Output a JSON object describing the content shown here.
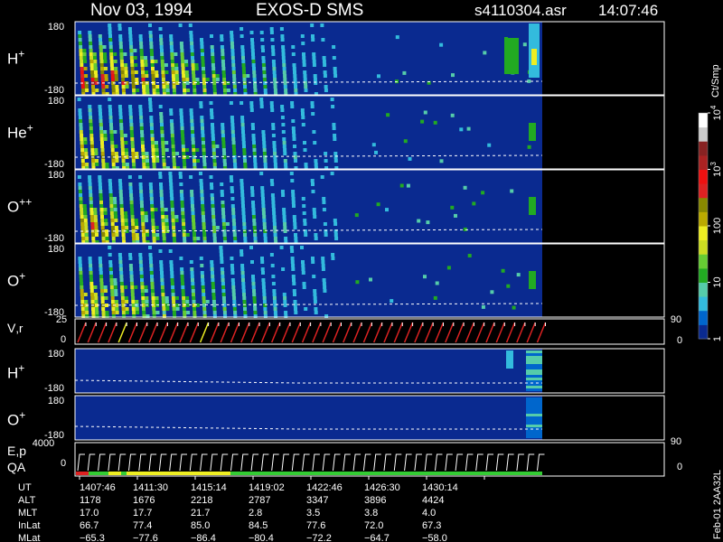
{
  "header": {
    "date": "Nov 03, 1994",
    "mission": "EXOS-D SMS",
    "file": "s4110304.asr",
    "time": "14:07:46"
  },
  "colorbar": {
    "label": "Ct/Smp",
    "ticks": [
      {
        "value": 1,
        "label": "1"
      },
      {
        "value": 10,
        "label": "10"
      },
      {
        "value": 100,
        "label": "100"
      },
      {
        "value": 1000,
        "label": "3",
        "base": "10"
      },
      {
        "value": 10000,
        "label": "4",
        "base": "10"
      }
    ],
    "colors": [
      "#0a2a90",
      "#0066cc",
      "#33bbdd",
      "#55ccaa",
      "#22aa22",
      "#66cc33",
      "#ccdd22",
      "#eeee22",
      "#bbaa00",
      "#888800",
      "#dd2222",
      "#ee1111",
      "#aa2222",
      "#882222",
      "#cccccc",
      "#ffffff"
    ]
  },
  "chart_data": {
    "type": "heatmap",
    "time_axis": {
      "range": [
        "1407:46",
        "1432:00"
      ],
      "tick_labels": [
        "1407:46",
        "1411:30",
        "1415:14",
        "1419:02",
        "1422:46",
        "1426:30",
        "1430:14"
      ]
    },
    "panels": [
      {
        "id": "H",
        "species": "H",
        "charge": "+",
        "ylim": [
          -180,
          180
        ],
        "ytick_labels": [
          "180",
          "-180"
        ],
        "band_max_fraction": 1.0
      },
      {
        "id": "He",
        "species": "He",
        "charge": "+",
        "ylim": [
          -180,
          180
        ],
        "ytick_labels": [
          "180",
          "-180"
        ],
        "band_max_fraction": 0.8
      },
      {
        "id": "Opp",
        "species": "O",
        "charge": "++",
        "ylim": [
          -180,
          180
        ],
        "ytick_labels": [
          "180",
          "-180"
        ],
        "band_max_fraction": 0.85
      },
      {
        "id": "O",
        "species": "O",
        "charge": "+",
        "ylim": [
          -180,
          180
        ],
        "ytick_labels": [
          "180",
          "-180"
        ],
        "band_max_fraction": 0.75
      }
    ],
    "vr_panel": {
      "label_main": "V",
      "label_sub": ",r",
      "ytick_labels": [
        "25",
        "0"
      ],
      "right_ticks": [
        "90",
        "0"
      ]
    },
    "lower_panels": [
      {
        "id": "H2",
        "species": "H",
        "charge": "+",
        "ytick_labels": [
          "180",
          "-180"
        ]
      },
      {
        "id": "O2",
        "species": "O",
        "charge": "+",
        "ytick_labels": [
          "180",
          "-180"
        ]
      }
    ],
    "ep_panel": {
      "label_top": "E,p",
      "label_bottom": "QA",
      "ytick_labels": [
        "4000",
        "0"
      ],
      "right_ticks": [
        "90",
        "0"
      ]
    }
  },
  "orbit_table": {
    "rows": [
      {
        "label": "UT",
        "values": [
          "1407:46",
          "1411:30",
          "1415:14",
          "1419:02",
          "1422:46",
          "1426:30",
          "1430:14"
        ]
      },
      {
        "label": "ALT",
        "values": [
          "1178",
          "1676",
          "2218",
          "2787",
          "3347",
          "3896",
          "4424"
        ]
      },
      {
        "label": "MLT",
        "values": [
          "17.0",
          "17.7",
          "21.7",
          "2.8",
          "3.5",
          "3.8",
          "4.0"
        ]
      },
      {
        "label": "InLat",
        "values": [
          "66.7",
          "77.4",
          "85.0",
          "84.5",
          "77.6",
          "72.0",
          "67.3"
        ]
      },
      {
        "label": "MLat",
        "values": [
          "−65.3",
          "−77.6",
          "−86.4",
          "−80.4",
          "−72.2",
          "−64.7",
          "−58.0"
        ]
      }
    ]
  },
  "footer": {
    "version": "Feb-01 2AA32L"
  }
}
